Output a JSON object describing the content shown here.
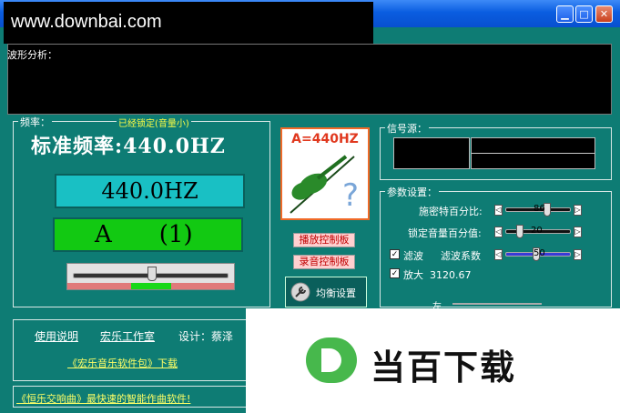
{
  "window": {
    "watermark": "www.downbai.com",
    "min_symbol": "▁",
    "max_symbol": "□",
    "close_symbol": "✕"
  },
  "waveform": {
    "label": "波形分析："
  },
  "frequency": {
    "group_label": "频率：",
    "lock_status": "已经锁定(音量小)",
    "title": "标准频率:440.0HZ",
    "display": "440.0HZ",
    "note": "A",
    "note_index": "(1)",
    "tuner_level": 0.5
  },
  "violin": {
    "label": "A=440HZ"
  },
  "buttons": {
    "play_panel": "播放控制板",
    "record_panel": "录音控制板",
    "equalizer": "均衡设置"
  },
  "signal": {
    "group_label": "信号源："
  },
  "params": {
    "group_label": "参数设置：",
    "rows": [
      {
        "label": "施密特百分比:",
        "value": "86"
      },
      {
        "label": "锁定音量百分值:",
        "value": "20"
      }
    ],
    "filter_checkbox": "滤波",
    "filter_coef_label": "滤波系数",
    "filter_value": "50",
    "amplify_checkbox": "放大",
    "amplify_value": "3120.67",
    "partial_label": "左"
  },
  "links": {
    "manual": "使用说明",
    "studio": "宏乐工作室",
    "design": "设计：蔡泽",
    "download": "《宏乐音乐软件包》下载",
    "promo": "《恒乐交响曲》最快速的智能作曲软件!"
  },
  "logo": {
    "text": "当百下载"
  }
}
